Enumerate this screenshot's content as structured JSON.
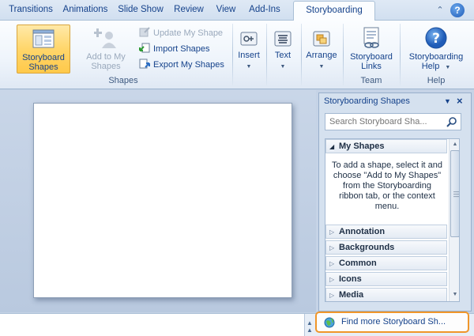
{
  "tabs": [
    {
      "label": "Transitions"
    },
    {
      "label": "Animations"
    },
    {
      "label": "Slide Show"
    },
    {
      "label": "Review"
    },
    {
      "label": "View"
    },
    {
      "label": "Add-Ins"
    },
    {
      "label": "Storyboarding",
      "active": true
    }
  ],
  "ribbon": {
    "shapes_group": {
      "label": "Shapes",
      "storyboard_shapes": "Storyboard Shapes",
      "add_to_my_shapes": "Add to My Shapes",
      "update_my_shape": "Update My Shape",
      "import_shapes": "Import Shapes",
      "export_my_shapes": "Export My Shapes"
    },
    "insert": "Insert",
    "text": "Text",
    "arrange": "Arrange",
    "team_group": {
      "label": "Team",
      "storyboard_links": "Storyboard Links"
    },
    "help_group": {
      "label": "Help",
      "storyboarding_help": "Storyboarding Help"
    }
  },
  "pane": {
    "title": "Storyboarding Shapes",
    "search_placeholder": "Search Storyboard Sha...",
    "categories": [
      {
        "label": "My Shapes",
        "expanded": true
      },
      {
        "label": "Annotation"
      },
      {
        "label": "Backgrounds"
      },
      {
        "label": "Common"
      },
      {
        "label": "Icons"
      },
      {
        "label": "Media"
      }
    ],
    "empty_message": "To add a shape, select it and choose \"Add to My Shapes\" from the Storyboarding ribbon tab, or the context menu.",
    "find_more": "Find more Storyboard Sh..."
  },
  "colors": {
    "accent": "#f0962a",
    "ribbon_text": "#15428b",
    "selected_button": "#ffd66b"
  }
}
